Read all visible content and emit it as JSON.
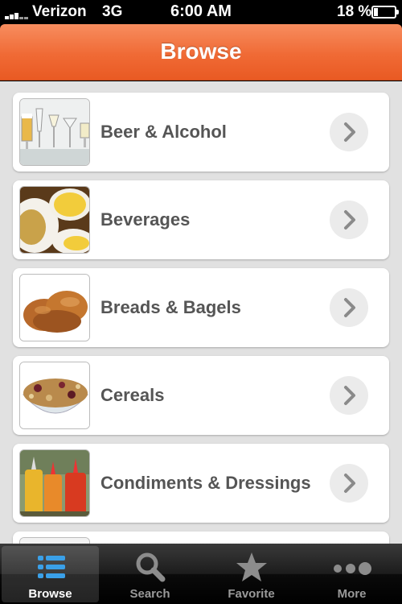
{
  "status_bar": {
    "carrier": "Verizon",
    "network": "3G",
    "time": "6:00 AM",
    "battery_percent": "18 %",
    "battery_level": 0.18
  },
  "nav": {
    "title": "Browse"
  },
  "categories": [
    {
      "label": "Beer & Alcohol",
      "image": "glasses-photo"
    },
    {
      "label": "Beverages",
      "image": "tea-lemon-photo"
    },
    {
      "label": "Breads & Bagels",
      "image": "bread-photo"
    },
    {
      "label": "Cereals",
      "image": "cereal-bowl-photo"
    },
    {
      "label": "Condiments & Dressings",
      "image": "condiment-bottles-photo"
    },
    {
      "label": "",
      "image": "partial-photo"
    }
  ],
  "tabs": [
    {
      "label": "Browse",
      "icon": "list-icon",
      "active": true
    },
    {
      "label": "Search",
      "icon": "search-icon",
      "active": false
    },
    {
      "label": "Favorite",
      "icon": "star-icon",
      "active": false
    },
    {
      "label": "More",
      "icon": "more-dots-icon",
      "active": false
    }
  ],
  "colors": {
    "nav_orange": "#f06a35",
    "background": "#e1e1e1",
    "label_text": "#555555",
    "active_tab_icon": "#3aa0e8"
  }
}
